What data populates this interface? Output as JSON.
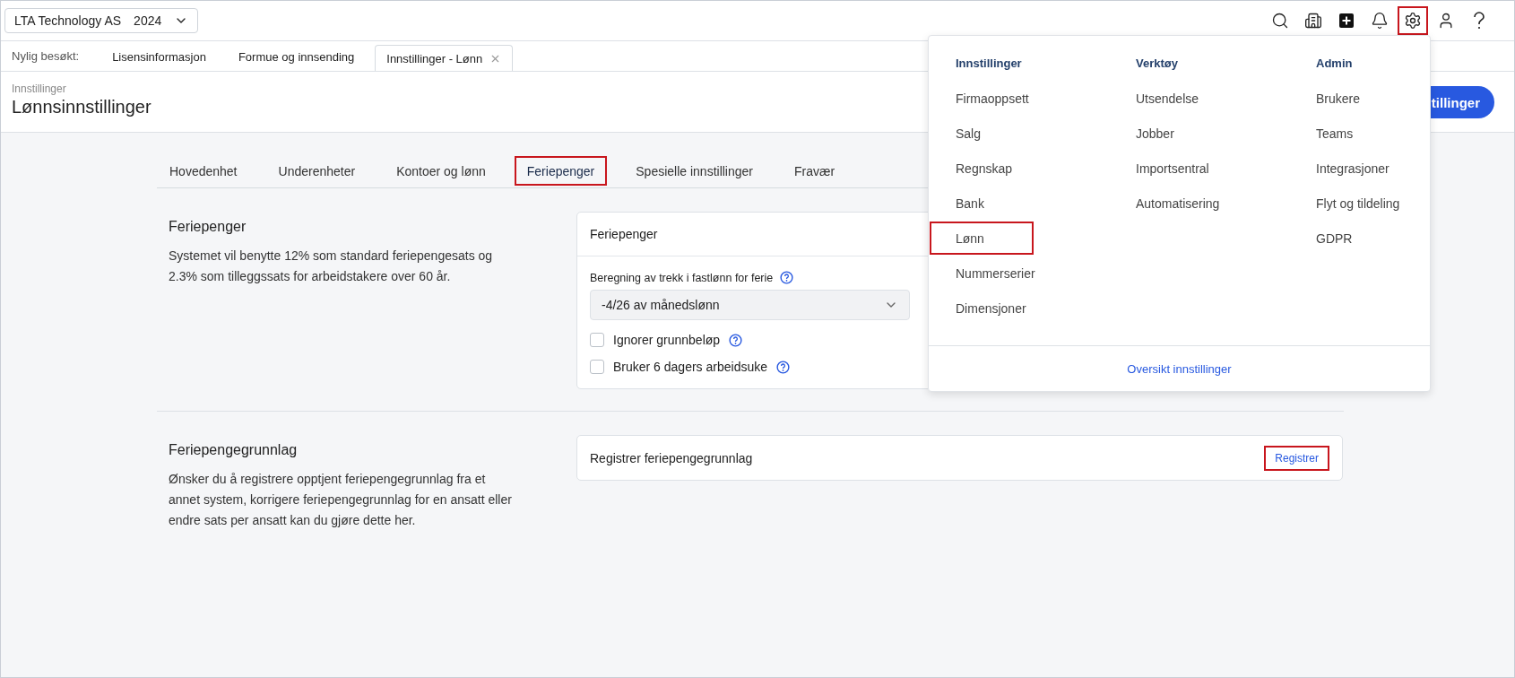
{
  "company_selector": {
    "company": "LTA Technology AS",
    "year": "2024"
  },
  "toolbar": [
    {
      "kind": "search",
      "highlighted": false
    },
    {
      "kind": "building",
      "highlighted": false
    },
    {
      "kind": "add",
      "highlighted": false
    },
    {
      "kind": "notifications",
      "highlighted": false
    },
    {
      "kind": "settings",
      "highlighted": true
    },
    {
      "kind": "user",
      "highlighted": false
    },
    {
      "kind": "help",
      "highlighted": false
    }
  ],
  "recent": {
    "label": "Nylig besøkt:",
    "items": [
      {
        "label": "Lisensinformasjon",
        "selected": false
      },
      {
        "label": "Formue og innsending",
        "selected": false
      },
      {
        "label": "Innstillinger - Lønn",
        "selected": true
      }
    ]
  },
  "page_header": {
    "breadcrumb": "Innstillinger",
    "title": "Lønnsinnstillinger",
    "action_button": "tillinger"
  },
  "tabs": [
    {
      "label": "Hovedenhet",
      "selected": false,
      "highlighted": false
    },
    {
      "label": "Underenheter",
      "selected": false,
      "highlighted": false
    },
    {
      "label": "Kontoer og lønn",
      "selected": false,
      "highlighted": false
    },
    {
      "label": "Feriepenger",
      "selected": true,
      "highlighted": true
    },
    {
      "label": "Spesielle innstillinger",
      "selected": false,
      "highlighted": false
    },
    {
      "label": "Fravær",
      "selected": false,
      "highlighted": false
    }
  ],
  "sections": [
    {
      "heading": "Feriepenger",
      "description": "Systemet vil benytte 12% som standard feriepengesats og 2.3% som tilleggssats for arbeidstakere over 60 år.",
      "card": {
        "kind": "form",
        "title": "Feriepenger",
        "field_label": "Beregning av trekk i fastlønn for ferie",
        "select_value": "-4/26 av månedslønn",
        "checkboxes": [
          {
            "label": "Ignorer grunnbeløp",
            "checked": false
          },
          {
            "label": "Bruker 6 dagers arbeidsuke",
            "checked": false
          }
        ]
      }
    },
    {
      "heading": "Feriepengegrunnlag",
      "description": "Ønsker du å registrere opptjent feriepengegrunnlag fra et annet system, korrigere feriepengegrunnlag for en ansatt eller endre sats per ansatt kan du gjøre dette her.",
      "card": {
        "kind": "action",
        "title": "Registrer feriepengegrunnlag",
        "button": "Registrer",
        "button_highlighted": true
      }
    }
  ],
  "settings_menu": {
    "columns": [
      {
        "heading": "Innstillinger",
        "items": [
          {
            "label": "Firmaoppsett",
            "highlighted": false
          },
          {
            "label": "Salg",
            "highlighted": false
          },
          {
            "label": "Regnskap",
            "highlighted": false
          },
          {
            "label": "Bank",
            "highlighted": false
          },
          {
            "label": "Lønn",
            "highlighted": true
          },
          {
            "label": "Nummerserier",
            "highlighted": false
          },
          {
            "label": "Dimensjoner",
            "highlighted": false
          }
        ]
      },
      {
        "heading": "Verktøy",
        "items": [
          {
            "label": "Utsendelse",
            "highlighted": false
          },
          {
            "label": "Jobber",
            "highlighted": false
          },
          {
            "label": "Importsentral",
            "highlighted": false
          },
          {
            "label": "Automatisering",
            "highlighted": false
          }
        ]
      },
      {
        "heading": "Admin",
        "items": [
          {
            "label": "Brukere",
            "highlighted": false
          },
          {
            "label": "Teams",
            "highlighted": false
          },
          {
            "label": "Integrasjoner",
            "highlighted": false
          },
          {
            "label": "Flyt og tildeling",
            "highlighted": false
          },
          {
            "label": "GDPR",
            "highlighted": false
          }
        ]
      }
    ],
    "footer_link": "Oversikt innstillinger"
  }
}
